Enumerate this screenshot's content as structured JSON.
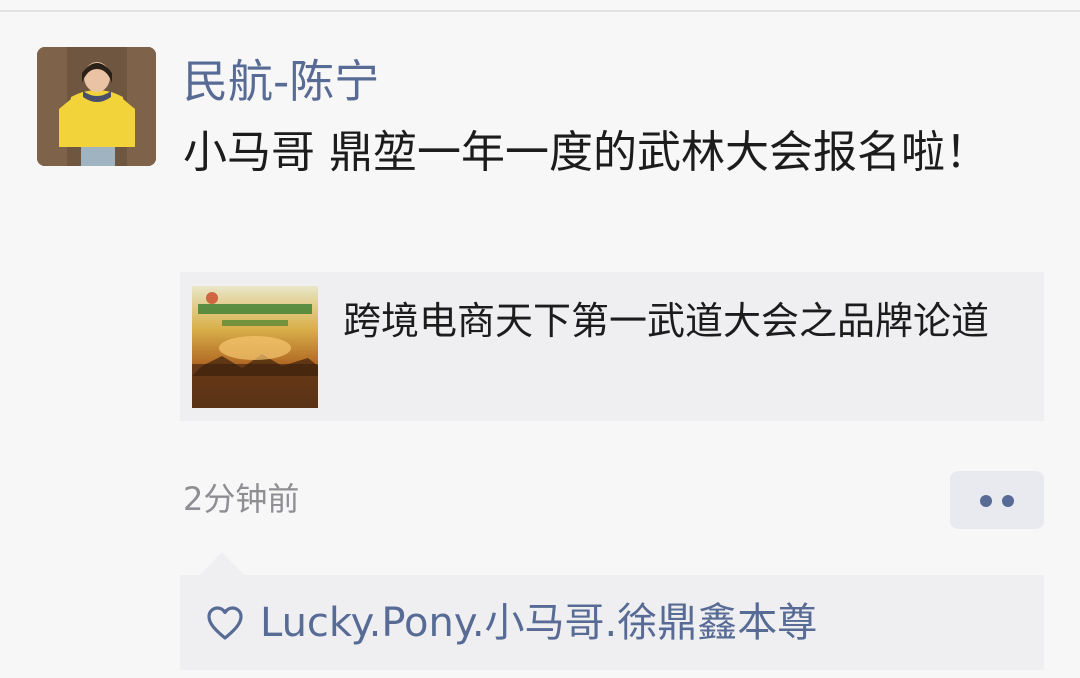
{
  "post": {
    "author": "民航-陈宁",
    "text": "小马哥 鼎堃一年一度的武林大会报名啦！",
    "timestamp": "2分钟前",
    "link": {
      "title": "跨境电商天下第一武道大会之品牌论道",
      "thumbnail_icon": "event-poster-thumbnail"
    },
    "more_icon": "two-dots-icon"
  },
  "likes": {
    "icon": "heart-outline-icon",
    "users": [
      "Lucky.Pony.小马哥.徐鼎鑫本尊"
    ]
  },
  "colors": {
    "link_blue": "#576b95",
    "body_text": "#1c1c1c",
    "muted": "#8e8e93",
    "panel_bg": "#efeff2",
    "page_bg": "#f7f7f7"
  }
}
